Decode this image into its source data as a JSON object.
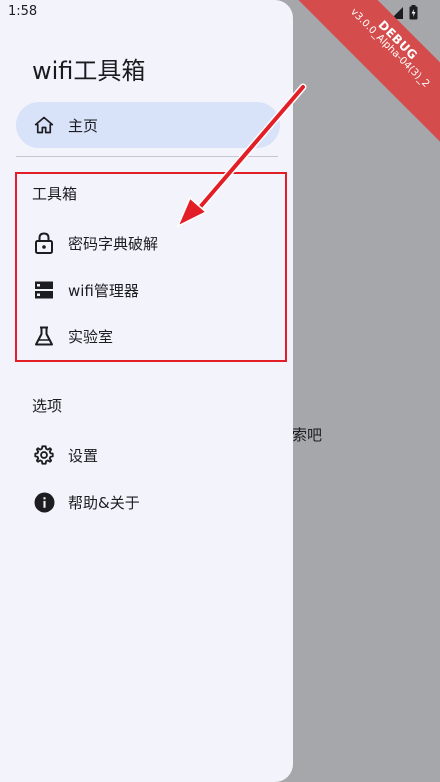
{
  "status": {
    "time": "1:58"
  },
  "debug_banner": {
    "label": "DEBUG",
    "version": "v3.0.0_Alpha-04(3)_2"
  },
  "background": {
    "partial_text": "索吧"
  },
  "drawer": {
    "title": "wifi工具箱",
    "home": {
      "label": "主页",
      "icon": "home-icon"
    },
    "sections": [
      {
        "title": "工具箱",
        "items": [
          {
            "label": "密码字典破解",
            "icon": "lock-icon"
          },
          {
            "label": "wifi管理器",
            "icon": "storage-icon"
          },
          {
            "label": "实验室",
            "icon": "flask-icon"
          }
        ]
      },
      {
        "title": "选项",
        "items": [
          {
            "label": "设置",
            "icon": "gear-icon"
          },
          {
            "label": "帮助&关于",
            "icon": "info-icon"
          }
        ]
      }
    ]
  },
  "colors": {
    "scrim": "#a6a7ab",
    "drawer_bg": "#f3f3fb",
    "selected_bg": "#d8e2f8",
    "annotation_red": "#e21f26",
    "debug_red": "#d54c4c"
  }
}
